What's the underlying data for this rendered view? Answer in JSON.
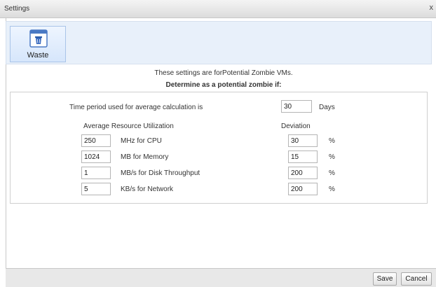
{
  "window": {
    "title": "Settings",
    "close_glyph": "x"
  },
  "toolbar": {
    "waste_label": "Waste",
    "waste_icon": "trash-icon"
  },
  "info": {
    "line1": "These settings are forPotential Zombie VMs.",
    "line2": "Determine as a potential zombie if:"
  },
  "time_period": {
    "label": "Time period used for average calculation is",
    "value": "30",
    "unit": "Days"
  },
  "headers": {
    "utilization": "Average Resource Utilization",
    "deviation": "Deviation"
  },
  "metrics": [
    {
      "value": "250",
      "label": "MHz for CPU",
      "deviation": "30",
      "unit": "%"
    },
    {
      "value": "1024",
      "label": "MB for Memory",
      "deviation": "15",
      "unit": "%"
    },
    {
      "value": "1",
      "label": "MB/s for Disk Throughput",
      "deviation": "200",
      "unit": "%"
    },
    {
      "value": "5",
      "label": "KB/s for Network",
      "deviation": "200",
      "unit": "%"
    }
  ],
  "footer": {
    "save_label": "Save",
    "cancel_label": "Cancel"
  }
}
